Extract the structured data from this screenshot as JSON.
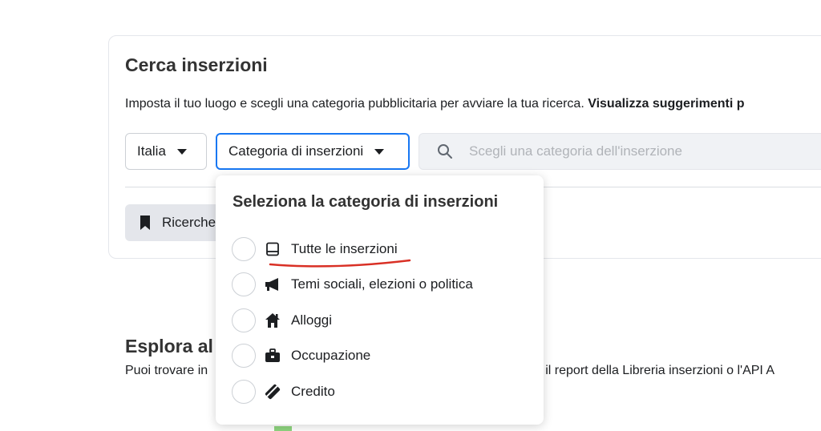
{
  "search": {
    "title": "Cerca inserzioni",
    "description": "Imposta il tuo luogo e scegli una categoria pubblicitaria per avviare la tua ricerca. ",
    "description_bold": "Visualizza suggerimenti p",
    "country_value": "Italia",
    "category_value": "Categoria di inserzioni",
    "input_placeholder": "Scegli una categoria dell'inserzione",
    "saved_label": "Ricerche"
  },
  "explore": {
    "title": "Esplora al",
    "text_start": "Puoi trovare in",
    "text_end": "do il report della Libreria inserzioni o l'API A"
  },
  "dropdown": {
    "title": "Seleziona la categoria di inserzioni",
    "options": [
      {
        "label": "Tutte le inserzioni",
        "icon": "monitor-icon",
        "selected": false
      },
      {
        "label": "Temi sociali, elezioni o politica",
        "icon": "megaphone-icon",
        "selected": false
      },
      {
        "label": "Alloggi",
        "icon": "house-icon",
        "selected": false
      },
      {
        "label": "Occupazione",
        "icon": "briefcase-icon",
        "selected": false
      },
      {
        "label": "Credito",
        "icon": "credit-card-icon",
        "selected": false
      }
    ]
  },
  "colors": {
    "accent": "#1877f2",
    "annotation": "#d93025"
  }
}
